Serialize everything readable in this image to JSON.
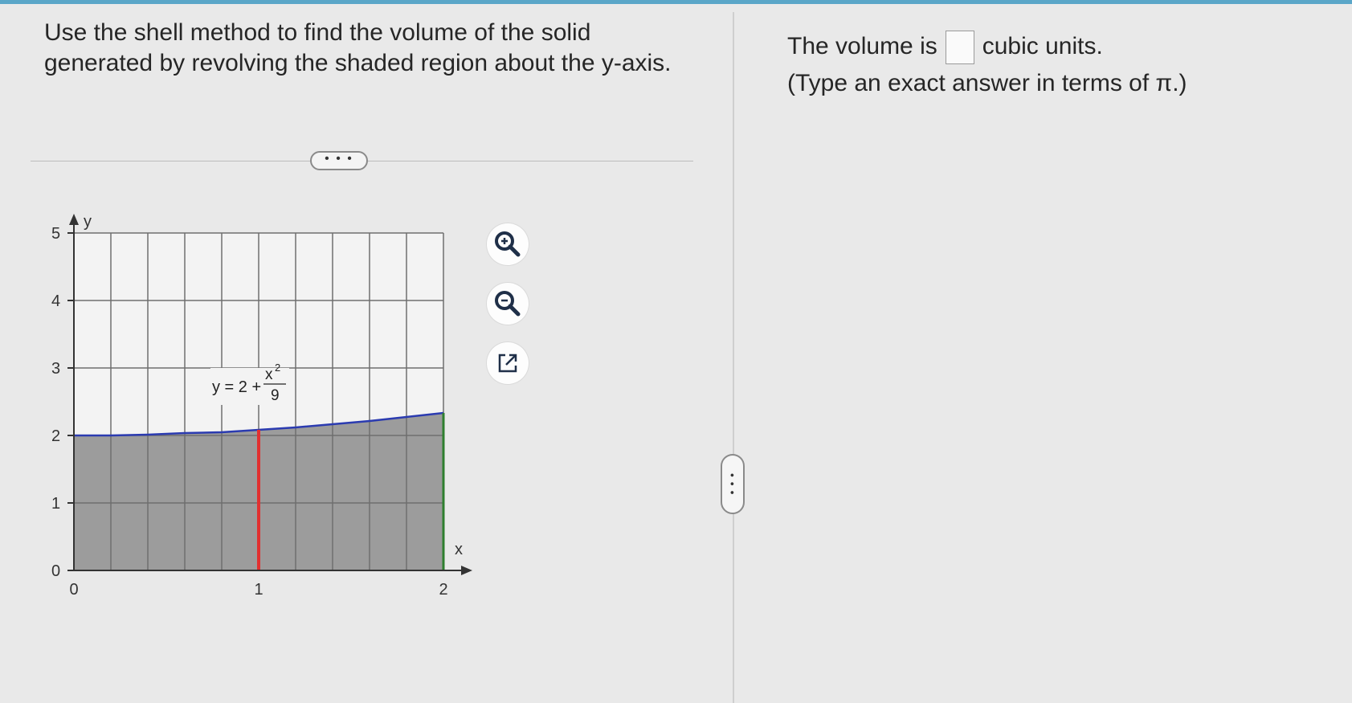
{
  "question": {
    "line1": "Use the shell method to find the volume of the solid",
    "line2": "generated by revolving the shaded region about the y-axis."
  },
  "more_button": "• • •",
  "graph": {
    "y_axis_label": "y",
    "x_axis_label": "x",
    "y_ticks": [
      "0",
      "1",
      "2",
      "3",
      "4",
      "5"
    ],
    "x_ticks": [
      "0",
      "1",
      "2"
    ],
    "curve_label_lhs": "y = 2 +",
    "curve_label_num": "x",
    "curve_label_exp": "2",
    "curve_label_den": "9",
    "shade_color": "#9c9c9c",
    "curve_color": "#2b3bb0",
    "shell_color": "#e23030",
    "boundary_color": "#2f7f2f"
  },
  "tools": {
    "zoom_in": "zoom-in-icon",
    "zoom_out": "zoom-out-icon",
    "pop_out": "external-link-icon"
  },
  "pane_handle": "• • •",
  "answer": {
    "prefix": "The volume is",
    "suffix": "cubic units.",
    "hint": "(Type an exact answer in terms of π.)"
  }
}
